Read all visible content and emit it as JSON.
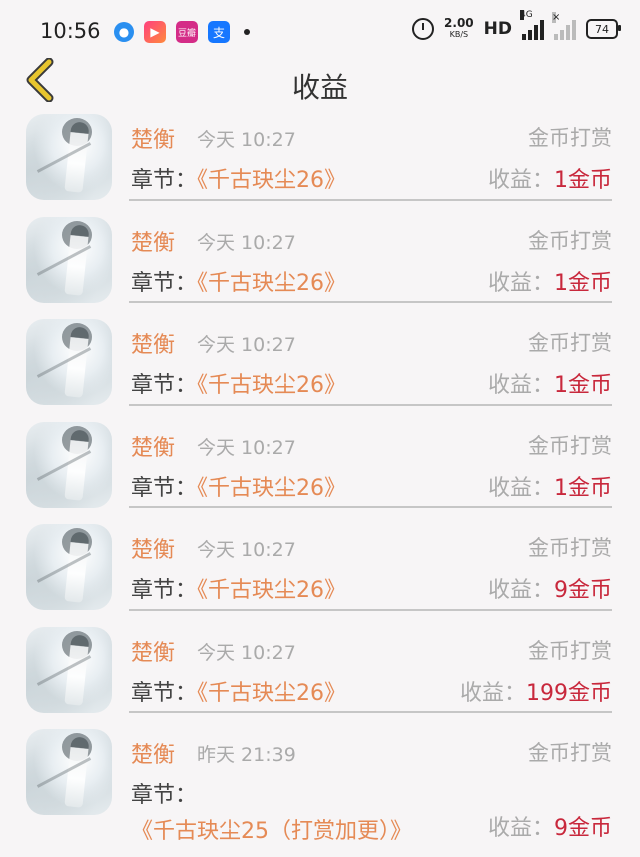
{
  "status_bar": {
    "time": "10:56",
    "speed_value": "2.00",
    "speed_unit": "KB/S",
    "hd": "HD",
    "network": "4G",
    "battery": "74",
    "icon_magenta_text": "豆瓣"
  },
  "header": {
    "title": "收益"
  },
  "labels": {
    "chapter_prefix": "章节：",
    "income_prefix": "收益："
  },
  "records": [
    {
      "name": "楚衡",
      "time": "今天 10:27",
      "type": "金币打赏",
      "chapter": "《千古玦尘26》",
      "amount": "1金币"
    },
    {
      "name": "楚衡",
      "time": "今天 10:27",
      "type": "金币打赏",
      "chapter": "《千古玦尘26》",
      "amount": "1金币"
    },
    {
      "name": "楚衡",
      "time": "今天 10:27",
      "type": "金币打赏",
      "chapter": "《千古玦尘26》",
      "amount": "1金币"
    },
    {
      "name": "楚衡",
      "time": "今天 10:27",
      "type": "金币打赏",
      "chapter": "《千古玦尘26》",
      "amount": "1金币"
    },
    {
      "name": "楚衡",
      "time": "今天 10:27",
      "type": "金币打赏",
      "chapter": "《千古玦尘26》",
      "amount": "9金币"
    },
    {
      "name": "楚衡",
      "time": "今天 10:27",
      "type": "金币打赏",
      "chapter": "《千古玦尘26》",
      "amount": "199金币"
    },
    {
      "name": "楚衡",
      "time": "昨天 21:39",
      "type": "金币打赏",
      "chapter": "《千古玦尘25（打赏加更）》",
      "amount": "9金币"
    }
  ],
  "colors": {
    "name": "#e58a55",
    "amount": "#c8283c",
    "muted": "#aaaaaa",
    "back_icon": "#e8c52e"
  }
}
